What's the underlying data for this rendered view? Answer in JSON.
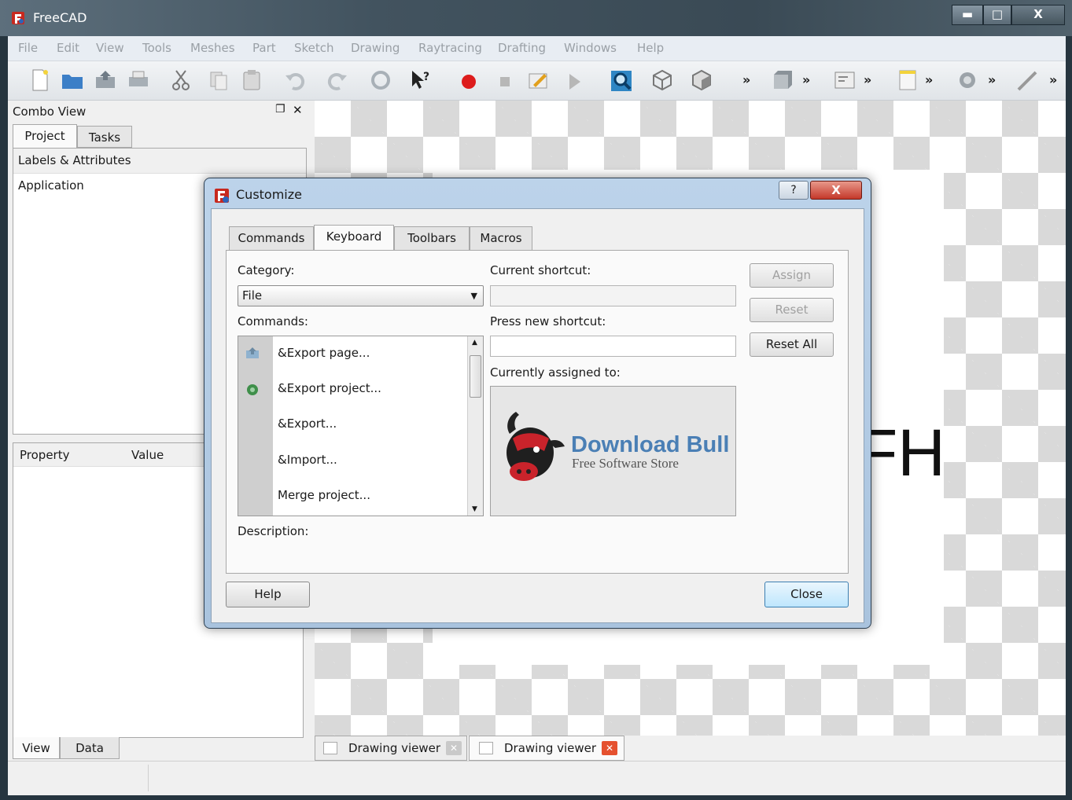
{
  "window": {
    "title": "FreeCAD",
    "controls": {
      "minimize": "▬",
      "maximize": "□",
      "close": "X"
    }
  },
  "menubar": {
    "items": [
      "File",
      "Edit",
      "View",
      "Tools",
      "Meshes",
      "Part",
      "Sketch",
      "Drawing",
      "Raytracing",
      "Drafting",
      "Windows",
      "Help"
    ]
  },
  "toolbar": {
    "overflow_label": "»"
  },
  "combo_view": {
    "title": "Combo View",
    "float_icon": "❐",
    "close_icon": "✕",
    "tabs": [
      "Project",
      "Tasks"
    ],
    "tree_header": "Labels & Attributes",
    "tree_items": [
      "Application"
    ],
    "property_headers": [
      "Property",
      "Value"
    ],
    "bottom_tabs": [
      "View",
      "Data"
    ]
  },
  "viewport": {
    "drawing_text": "FH",
    "doc_tabs": [
      "Drawing viewer",
      "Drawing viewer"
    ]
  },
  "dialog": {
    "title": "Customize",
    "help_glyph": "?",
    "close_glyph": "X",
    "tabs": [
      "Commands",
      "Keyboard",
      "Toolbars",
      "Macros"
    ],
    "active_tab": "Keyboard",
    "category_label": "Category:",
    "category_value": "File",
    "commands_label": "Commands:",
    "commands": [
      "&Export page...",
      "&Export project...",
      "&Export...",
      "&Import...",
      "Merge project..."
    ],
    "current_shortcut_label": "Current shortcut:",
    "current_shortcut_value": "",
    "new_shortcut_label": "Press new shortcut:",
    "new_shortcut_value": "",
    "assigned_label": "Currently assigned to:",
    "watermark": {
      "title": "Download Bull",
      "subtitle": "Free Software Store"
    },
    "description_label": "Description:",
    "buttons": {
      "assign": "Assign",
      "reset": "Reset",
      "reset_all": "Reset All",
      "help": "Help",
      "close": "Close"
    }
  },
  "colors": {
    "titlebar": "#42535f",
    "dialog_frame": "#a9c3de",
    "record_red": "#dd1c1c",
    "close_red": "#c4382a",
    "watermark_blue": "#4a7fb5"
  }
}
